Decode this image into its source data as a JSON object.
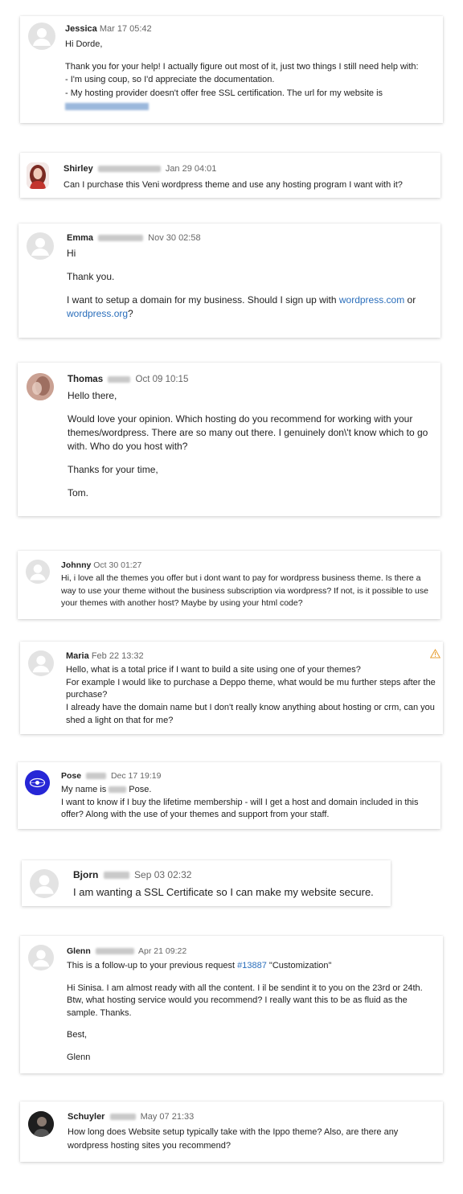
{
  "messages": [
    {
      "name": "Jessica",
      "date": "Mar 17  05:42",
      "lines": [
        "Hi Dorde,",
        "",
        "Thank you for your help! I actually figure out most of it, just two things I still need help with:",
        "- I'm using coup, so I'd appreciate the documentation.",
        "- My hosting provider doesn't offer free SSL certification. The url for my website is"
      ]
    },
    {
      "name": "Shirley",
      "date": "Jan 29  04:01",
      "lines": [
        "Can I purchase this Veni wordpress theme and use any hosting program I want with it?"
      ]
    },
    {
      "name": "Emma",
      "date": "Nov 30  02:58",
      "lines": [
        "Hi",
        "",
        "Thank you.",
        ""
      ],
      "last_pre": "I want to setup a domain for my business.  Should I sign up with ",
      "link1": "wordpress.com",
      "mid": " or",
      "link2": "wordpress.org",
      "end": "?"
    },
    {
      "name": "Thomas",
      "date": "Oct 09  10:15",
      "lines": [
        "Hello there,",
        "",
        "Would love your opinion. Which hosting do you recommend for working with your themes/wordpress. There are so many out there. I genuinely don\\'t know which to go with. Who do you host with?",
        "",
        "Thanks for your time,",
        "",
        "Tom."
      ]
    },
    {
      "name": "Johnny",
      "date": "Oct 30  01:27",
      "lines": [
        "Hi, i love all the themes you offer but i dont want to pay for wordpress business theme. Is there a way to use your theme without the business subscription via wordpress? If not, is it possible to use your themes with another host? Maybe by using your html code?"
      ]
    },
    {
      "name": "Maria",
      "date": "Feb 22  13:32",
      "lines": [
        "Hello, what is a total price if I want to build a site using one of your themes?",
        "For example I would like to purchase a Deppo theme, what would be mu further steps after the purchase?",
        "I already have the domain name but I don't really know anything about hosting or crm, can you shed a light on that for me?"
      ]
    },
    {
      "name": "Pose",
      "date": "Dec 17  19:19",
      "line1_pre": "My name is",
      "line1_post": "Pose.",
      "lines": [
        "I want to know if I buy the lifetime membership - will I get a host and domain included in this offer? Along with the use of your themes and support from your staff."
      ]
    },
    {
      "name": "Bjorn",
      "date": "Sep 03  02:32",
      "lines": [
        "I am wanting a SSL Certificate so I can make my website secure."
      ]
    },
    {
      "name": "Glenn",
      "date": "Apr 21  09:22",
      "followup_pre": "This is a follow-up to your previous request ",
      "followup_link": "#13887",
      "followup_post": " \"Customization\"",
      "lines": [
        "",
        "Hi Sinisa. I am almost ready with all the content. I il be sendint it to you on the 23rd or 24th. Btw, what hosting service would you recommend? I really want this to be as fluid as the sample. Thanks.",
        "",
        "Best,",
        "",
        "Glenn"
      ]
    },
    {
      "name": "Schuyler",
      "date": "May 07  21:33",
      "lines": [
        "How long does Website setup typically take with the Ippo theme? Also, are there any wordpress hosting sites you recommend?"
      ]
    }
  ],
  "colors": {
    "link": "#2a6ebb",
    "warning": "#e8a23a",
    "pose_avatar": "#2626d6"
  },
  "icons": {
    "default_avatar": "person-icon",
    "warning": "warning-triangle-icon"
  }
}
